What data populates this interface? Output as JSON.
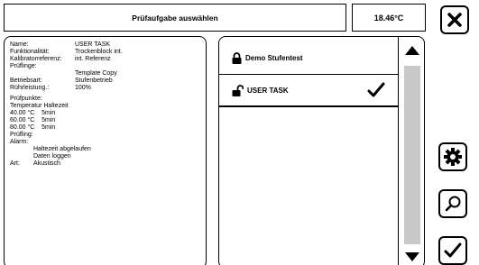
{
  "header": {
    "title": "Prüfaufgabe auswählen",
    "temperature": "18.46°C"
  },
  "buttons": {
    "close_icon": "close-icon",
    "settings_icon": "gear-icon",
    "search_icon": "search-icon",
    "confirm_icon": "checkmark-icon"
  },
  "info": {
    "name_key": "Name:",
    "name_val": "USER TASK",
    "func_key": "Funktionalität:",
    "func_val": "Trockenblock int.",
    "ref_key": "Kalibratorreferenz:",
    "ref_val": "int. Referenz",
    "dut_key": "Prüflinge:",
    "dut_val": "Template Copy",
    "mode_key": "Betriebsart:",
    "mode_val": "Stufenbetrieb",
    "stir_key": "Rührleistung.:",
    "stir_val": "100%",
    "points_title": "Prüfpunkte:",
    "points_header": "Temperatur Haltezeit",
    "points": [
      "40.00 °C    5min",
      "60.00 °C    5min",
      "80.00 °C    5min"
    ],
    "dut_label": "Prüfling:",
    "alarm_label": "Alarm:",
    "alarm_lines": [
      "Haltezeit abgelaufen",
      "Daten loggen"
    ],
    "type_key": "Art:",
    "type_val": "Akustisch"
  },
  "list": {
    "items": [
      {
        "label": "Demo Stufentest",
        "locked": true,
        "selected": false
      },
      {
        "label": "USER TASK",
        "locked": false,
        "selected": true
      }
    ]
  },
  "colors": {
    "scroll_track": "#c8c8c8",
    "border": "#000000"
  }
}
